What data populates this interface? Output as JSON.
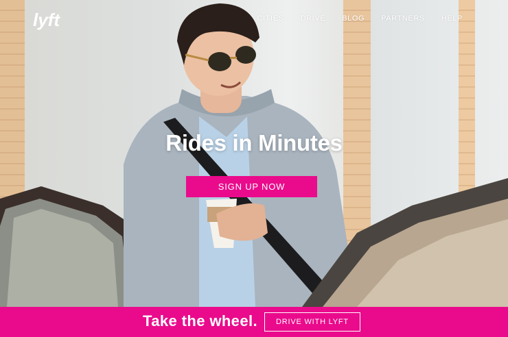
{
  "brand": {
    "logo_text": "lyft",
    "primary_color": "#ea0b8c"
  },
  "nav": {
    "items": [
      {
        "label": "CITIES"
      },
      {
        "label": "DRIVE"
      },
      {
        "label": "BLOG"
      },
      {
        "label": "PARTNERS"
      },
      {
        "label": "HELP"
      }
    ]
  },
  "hero": {
    "headline": "Rides in Minutes",
    "cta_label": "SIGN UP NOW",
    "image": "man-with-sunglasses-holding-coffee-opening-car-door"
  },
  "footer_bar": {
    "tagline": "Take the wheel.",
    "cta_label": "DRIVE WITH LYFT"
  }
}
